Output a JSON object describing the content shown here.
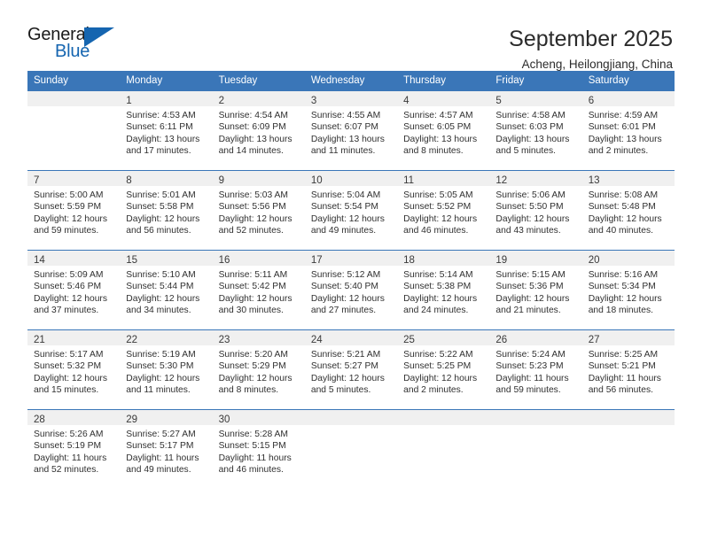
{
  "brand": {
    "name_top": "General",
    "name_bottom": "Blue",
    "accent_color": "#1565b0",
    "triangle_icon": "brand-triangle-icon"
  },
  "header": {
    "title": "September 2025",
    "subtitle": "Acheng, Heilongjiang, China",
    "header_bg_color": "#3a76b8",
    "daynum_band_color": "#f0f0f0"
  },
  "weekday_headers": [
    "Sunday",
    "Monday",
    "Tuesday",
    "Wednesday",
    "Thursday",
    "Friday",
    "Saturday"
  ],
  "weeks": [
    [
      {
        "day": "",
        "empty": true,
        "sunrise": "",
        "sunset": "",
        "daylight_1": "",
        "daylight_2": ""
      },
      {
        "day": "1",
        "sunrise": "Sunrise: 4:53 AM",
        "sunset": "Sunset: 6:11 PM",
        "daylight_1": "Daylight: 13 hours",
        "daylight_2": "and 17 minutes."
      },
      {
        "day": "2",
        "sunrise": "Sunrise: 4:54 AM",
        "sunset": "Sunset: 6:09 PM",
        "daylight_1": "Daylight: 13 hours",
        "daylight_2": "and 14 minutes."
      },
      {
        "day": "3",
        "sunrise": "Sunrise: 4:55 AM",
        "sunset": "Sunset: 6:07 PM",
        "daylight_1": "Daylight: 13 hours",
        "daylight_2": "and 11 minutes."
      },
      {
        "day": "4",
        "sunrise": "Sunrise: 4:57 AM",
        "sunset": "Sunset: 6:05 PM",
        "daylight_1": "Daylight: 13 hours",
        "daylight_2": "and 8 minutes."
      },
      {
        "day": "5",
        "sunrise": "Sunrise: 4:58 AM",
        "sunset": "Sunset: 6:03 PM",
        "daylight_1": "Daylight: 13 hours",
        "daylight_2": "and 5 minutes."
      },
      {
        "day": "6",
        "sunrise": "Sunrise: 4:59 AM",
        "sunset": "Sunset: 6:01 PM",
        "daylight_1": "Daylight: 13 hours",
        "daylight_2": "and 2 minutes."
      }
    ],
    [
      {
        "day": "7",
        "sunrise": "Sunrise: 5:00 AM",
        "sunset": "Sunset: 5:59 PM",
        "daylight_1": "Daylight: 12 hours",
        "daylight_2": "and 59 minutes."
      },
      {
        "day": "8",
        "sunrise": "Sunrise: 5:01 AM",
        "sunset": "Sunset: 5:58 PM",
        "daylight_1": "Daylight: 12 hours",
        "daylight_2": "and 56 minutes."
      },
      {
        "day": "9",
        "sunrise": "Sunrise: 5:03 AM",
        "sunset": "Sunset: 5:56 PM",
        "daylight_1": "Daylight: 12 hours",
        "daylight_2": "and 52 minutes."
      },
      {
        "day": "10",
        "sunrise": "Sunrise: 5:04 AM",
        "sunset": "Sunset: 5:54 PM",
        "daylight_1": "Daylight: 12 hours",
        "daylight_2": "and 49 minutes."
      },
      {
        "day": "11",
        "sunrise": "Sunrise: 5:05 AM",
        "sunset": "Sunset: 5:52 PM",
        "daylight_1": "Daylight: 12 hours",
        "daylight_2": "and 46 minutes."
      },
      {
        "day": "12",
        "sunrise": "Sunrise: 5:06 AM",
        "sunset": "Sunset: 5:50 PM",
        "daylight_1": "Daylight: 12 hours",
        "daylight_2": "and 43 minutes."
      },
      {
        "day": "13",
        "sunrise": "Sunrise: 5:08 AM",
        "sunset": "Sunset: 5:48 PM",
        "daylight_1": "Daylight: 12 hours",
        "daylight_2": "and 40 minutes."
      }
    ],
    [
      {
        "day": "14",
        "sunrise": "Sunrise: 5:09 AM",
        "sunset": "Sunset: 5:46 PM",
        "daylight_1": "Daylight: 12 hours",
        "daylight_2": "and 37 minutes."
      },
      {
        "day": "15",
        "sunrise": "Sunrise: 5:10 AM",
        "sunset": "Sunset: 5:44 PM",
        "daylight_1": "Daylight: 12 hours",
        "daylight_2": "and 34 minutes."
      },
      {
        "day": "16",
        "sunrise": "Sunrise: 5:11 AM",
        "sunset": "Sunset: 5:42 PM",
        "daylight_1": "Daylight: 12 hours",
        "daylight_2": "and 30 minutes."
      },
      {
        "day": "17",
        "sunrise": "Sunrise: 5:12 AM",
        "sunset": "Sunset: 5:40 PM",
        "daylight_1": "Daylight: 12 hours",
        "daylight_2": "and 27 minutes."
      },
      {
        "day": "18",
        "sunrise": "Sunrise: 5:14 AM",
        "sunset": "Sunset: 5:38 PM",
        "daylight_1": "Daylight: 12 hours",
        "daylight_2": "and 24 minutes."
      },
      {
        "day": "19",
        "sunrise": "Sunrise: 5:15 AM",
        "sunset": "Sunset: 5:36 PM",
        "daylight_1": "Daylight: 12 hours",
        "daylight_2": "and 21 minutes."
      },
      {
        "day": "20",
        "sunrise": "Sunrise: 5:16 AM",
        "sunset": "Sunset: 5:34 PM",
        "daylight_1": "Daylight: 12 hours",
        "daylight_2": "and 18 minutes."
      }
    ],
    [
      {
        "day": "21",
        "sunrise": "Sunrise: 5:17 AM",
        "sunset": "Sunset: 5:32 PM",
        "daylight_1": "Daylight: 12 hours",
        "daylight_2": "and 15 minutes."
      },
      {
        "day": "22",
        "sunrise": "Sunrise: 5:19 AM",
        "sunset": "Sunset: 5:30 PM",
        "daylight_1": "Daylight: 12 hours",
        "daylight_2": "and 11 minutes."
      },
      {
        "day": "23",
        "sunrise": "Sunrise: 5:20 AM",
        "sunset": "Sunset: 5:29 PM",
        "daylight_1": "Daylight: 12 hours",
        "daylight_2": "and 8 minutes."
      },
      {
        "day": "24",
        "sunrise": "Sunrise: 5:21 AM",
        "sunset": "Sunset: 5:27 PM",
        "daylight_1": "Daylight: 12 hours",
        "daylight_2": "and 5 minutes."
      },
      {
        "day": "25",
        "sunrise": "Sunrise: 5:22 AM",
        "sunset": "Sunset: 5:25 PM",
        "daylight_1": "Daylight: 12 hours",
        "daylight_2": "and 2 minutes."
      },
      {
        "day": "26",
        "sunrise": "Sunrise: 5:24 AM",
        "sunset": "Sunset: 5:23 PM",
        "daylight_1": "Daylight: 11 hours",
        "daylight_2": "and 59 minutes."
      },
      {
        "day": "27",
        "sunrise": "Sunrise: 5:25 AM",
        "sunset": "Sunset: 5:21 PM",
        "daylight_1": "Daylight: 11 hours",
        "daylight_2": "and 56 minutes."
      }
    ],
    [
      {
        "day": "28",
        "sunrise": "Sunrise: 5:26 AM",
        "sunset": "Sunset: 5:19 PM",
        "daylight_1": "Daylight: 11 hours",
        "daylight_2": "and 52 minutes."
      },
      {
        "day": "29",
        "sunrise": "Sunrise: 5:27 AM",
        "sunset": "Sunset: 5:17 PM",
        "daylight_1": "Daylight: 11 hours",
        "daylight_2": "and 49 minutes."
      },
      {
        "day": "30",
        "sunrise": "Sunrise: 5:28 AM",
        "sunset": "Sunset: 5:15 PM",
        "daylight_1": "Daylight: 11 hours",
        "daylight_2": "and 46 minutes."
      },
      {
        "day": "",
        "empty": true,
        "sunrise": "",
        "sunset": "",
        "daylight_1": "",
        "daylight_2": ""
      },
      {
        "day": "",
        "empty": true,
        "sunrise": "",
        "sunset": "",
        "daylight_1": "",
        "daylight_2": ""
      },
      {
        "day": "",
        "empty": true,
        "sunrise": "",
        "sunset": "",
        "daylight_1": "",
        "daylight_2": ""
      },
      {
        "day": "",
        "empty": true,
        "sunrise": "",
        "sunset": "",
        "daylight_1": "",
        "daylight_2": ""
      }
    ]
  ]
}
